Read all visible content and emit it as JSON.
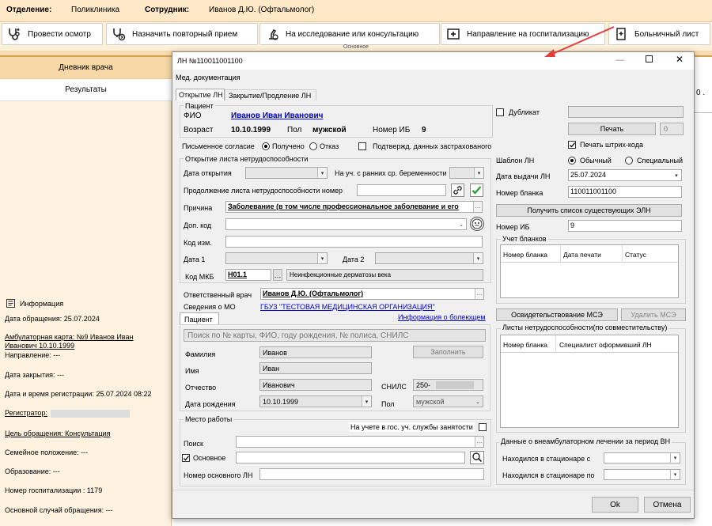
{
  "topbar": {
    "dept_label": "Отделение:",
    "dept_value": "Поликлиника",
    "emp_label": "Сотрудник:",
    "emp_value": "Иванов Д.Ю. (Офтальмолог)"
  },
  "toolbar": {
    "exam": "Провести осмотр",
    "repeat": "Назначить повторный прием",
    "research": "На исследование или консультацию",
    "hosp": "Направление на госпитализацию",
    "sick": "Больничный лист",
    "group_label": "Основное"
  },
  "leftpanel": {
    "diary": "Дневник врача",
    "results": "Результаты",
    "info_title": "Информация",
    "lines": [
      "Дата обращения: 25.07.2024",
      "Амбулаторная карта: №9 Иванов Иван",
      "Иванович 10.10.1999",
      "Направление: ---",
      "Дата закрытия: ---",
      "Дата и время регистрации: 25.07.2024 08:22",
      "Регистратор:",
      "Цель обращения: Консультация",
      "Семейное положение: ---",
      "Образование: ---",
      "Номер госпитализации : 1179",
      "Основной случай обращения: ---"
    ]
  },
  "dialog": {
    "title": "ЛН №110011001100",
    "menu": "Мед. документация",
    "tab_open": "Открытие ЛН",
    "tab_close": "Закрытие/Продление ЛН",
    "patient_group": "Пациент",
    "fio_label": "ФИО",
    "fio_value": "Иванов Иван Иванович",
    "age_label": "Возраст",
    "age_value": "10.10.1999",
    "sex_label": "Пол",
    "sex_value": "мужской",
    "ib_label": "Номер ИБ",
    "ib_value": "9",
    "consent_label": "Письменное согласие",
    "consent_yes": "Получено",
    "consent_no": "Отказ",
    "insured_confirm": "Подтвержд. данных застрахованого",
    "opening_group": "Открытие листа нетрудоспособности",
    "open_date_label": "Дата открытия",
    "pregnancy_label": "На уч. с ранних ср. беременности",
    "continuation_label": "Продолжение листа нетрудоспособности номер",
    "reason_label": "Причина",
    "reason_value": "Заболевание (в том числе профессиональное заболевание и его",
    "addcode_label": "Доп. код",
    "changecode_label": "Код изм.",
    "date1_label": "Дата 1",
    "date2_label": "Дата 2",
    "mkb_label": "Код МКБ",
    "mkb_code": "H01.1",
    "mkb_desc": "Неинфекционные дерматозы века",
    "resp_doctor_label": "Ответственный врач",
    "resp_doctor_value": "Иванов Д.Ю. (Офтальмолог)",
    "mo_label": "Сведения о МО",
    "mo_value": "ГБУЗ \"ТЕСТОВАЯ МЕДИЦИНСКАЯ ОРГАНИЗАЦИЯ\"",
    "patient_tab": "Пациент",
    "patient_info_link": "Информация о болеющем",
    "search_placeholder": "Поиск по № карты, ФИО, году рождения, № полиса, СНИЛС",
    "surname_label": "Фамилия",
    "surname_value": "Иванов",
    "fill_button": "Заполнить",
    "name_label": "Имя",
    "name_value": "Иван",
    "patronymic_label": "Отчество",
    "patronymic_value": "Иванович",
    "snils_label": "СНИЛС",
    "snils_value": "250-",
    "birth_label": "Дата рождения",
    "birth_value": "10.10.1999",
    "sex2_label": "Пол",
    "sex2_value": "мужской",
    "work_group": "Место работы",
    "employment_label": "На учете в гос. уч. службы занятости",
    "work_search_label": "Поиск",
    "main_label": "Основное",
    "main_ln_label": "Номер основного ЛН",
    "duplicate_label": "Дубликат",
    "print_button": "Печать",
    "print_count": "0",
    "barcode_label": "Печать штрих-кода",
    "template_label": "Шаблон ЛН",
    "template_normal": "Обычный",
    "template_special": "Специальный",
    "issue_date_label": "Дата выдачи ЛН",
    "issue_date_value": "25.07.2024",
    "blank_no_label": "Номер бланка",
    "blank_no_value": "110011001100",
    "get_eln_button": "Получить список существующих ЭЛН",
    "ib2_label": "Номер ИБ",
    "ib2_value": "9",
    "blanks_group": "Учет бланков",
    "blanks_cols": [
      "Номер бланка",
      "Дата печати",
      "Статус"
    ],
    "mse_button": "Освидетельствование МСЭ",
    "delete_mse_button": "Удалить МСЭ",
    "sheets_group": "Листы нетрудоспособности(по совместительству)",
    "sheets_cols": [
      "Номер бланка",
      "Специалист оформивший ЛН"
    ],
    "outpatient_group": "Данные о внеамбулаторном лечении за период ВН",
    "hosp_from_label": "Находился в стационаре с",
    "hosp_to_label": "Находился в стационаре по",
    "ok_button": "Ok",
    "cancel_button": "Отмена"
  },
  "colors": {
    "accent_orange": "#d8a24c",
    "link": "#0000cc",
    "annotation_arrow": "#e0403a",
    "check_green": "#2e9e3a"
  }
}
